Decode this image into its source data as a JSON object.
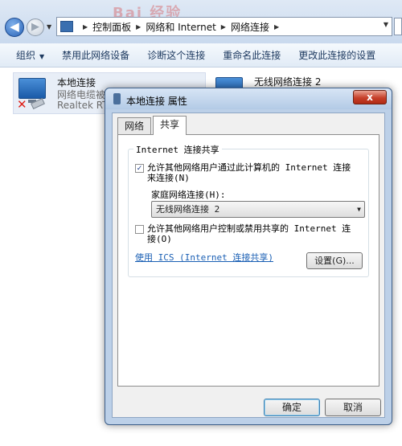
{
  "explorer": {
    "watermark": "Bai 经验",
    "breadcrumb": [
      "控制面板",
      "网络和 Internet",
      "网络连接"
    ],
    "commands": [
      "组织",
      "禁用此网络设备",
      "诊断这个连接",
      "重命名此连接",
      "更改此连接的设置"
    ],
    "connections": [
      {
        "name": "本地连接",
        "status": "网络电缆被",
        "device": "Realtek RT"
      },
      {
        "name": "无线网络连接 2"
      }
    ]
  },
  "dialog": {
    "title": "本地连接 属性",
    "close_label": "x",
    "tabs": [
      "网络",
      "共享"
    ],
    "active_tab": "共享",
    "group_title": "Internet 连接共享",
    "allow_share": {
      "label": "允许其他网络用户通过此计算机的 Internet 连接来连接(N)",
      "checked": true,
      "check_mark": "✓"
    },
    "home_network_label": "家庭网络连接(H):",
    "home_network_value": "无线网络连接 2",
    "allow_control": {
      "label": "允许其他网络用户控制或禁用共享的 Internet 连接(O)",
      "checked": false
    },
    "ics_link": "使用 ICS (Internet 连接共享)",
    "settings_button": "设置(G)...",
    "ok_button": "确定",
    "cancel_button": "取消"
  }
}
